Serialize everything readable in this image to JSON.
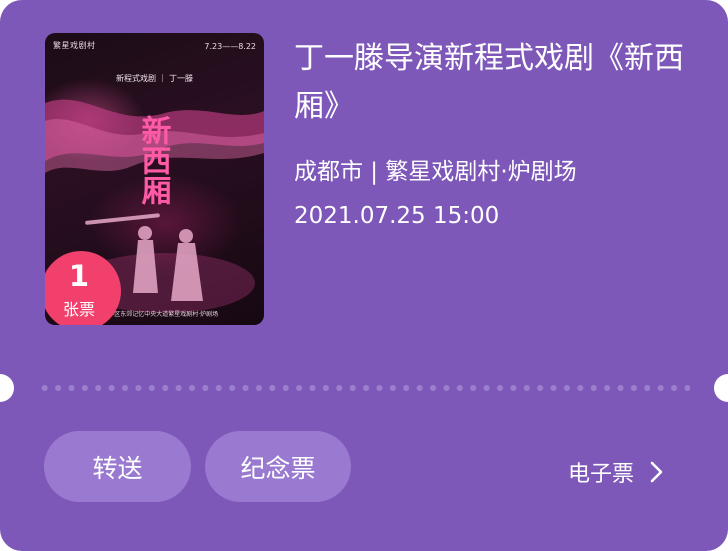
{
  "poster": {
    "brand": "繁星戏剧村",
    "dates": "7.23——8.22",
    "credit": "新程式戏剧 ｜ 丁一滕",
    "title": "新西厢",
    "venue_line": "• 成华区东郊记忆中央大道繁星戏剧村·炉剧场"
  },
  "badge": {
    "count": "1",
    "unit": "张票",
    "color": "#f2406d"
  },
  "event": {
    "title": "丁一滕导演新程式戏剧《新西厢》",
    "venue": "成都市 | 繁星戏剧村·炉剧场",
    "datetime": "2021.07.25 15:00"
  },
  "actions": {
    "transfer_label": "转送",
    "souvenir_label": "纪念票",
    "eticket_label": "电子票"
  },
  "colors": {
    "card_bg": "#7e58b9",
    "button_bg": "#9a7ad0",
    "badge_bg": "#f2406d"
  },
  "icons": {
    "eticket_arrow": "chevron-right-icon"
  }
}
